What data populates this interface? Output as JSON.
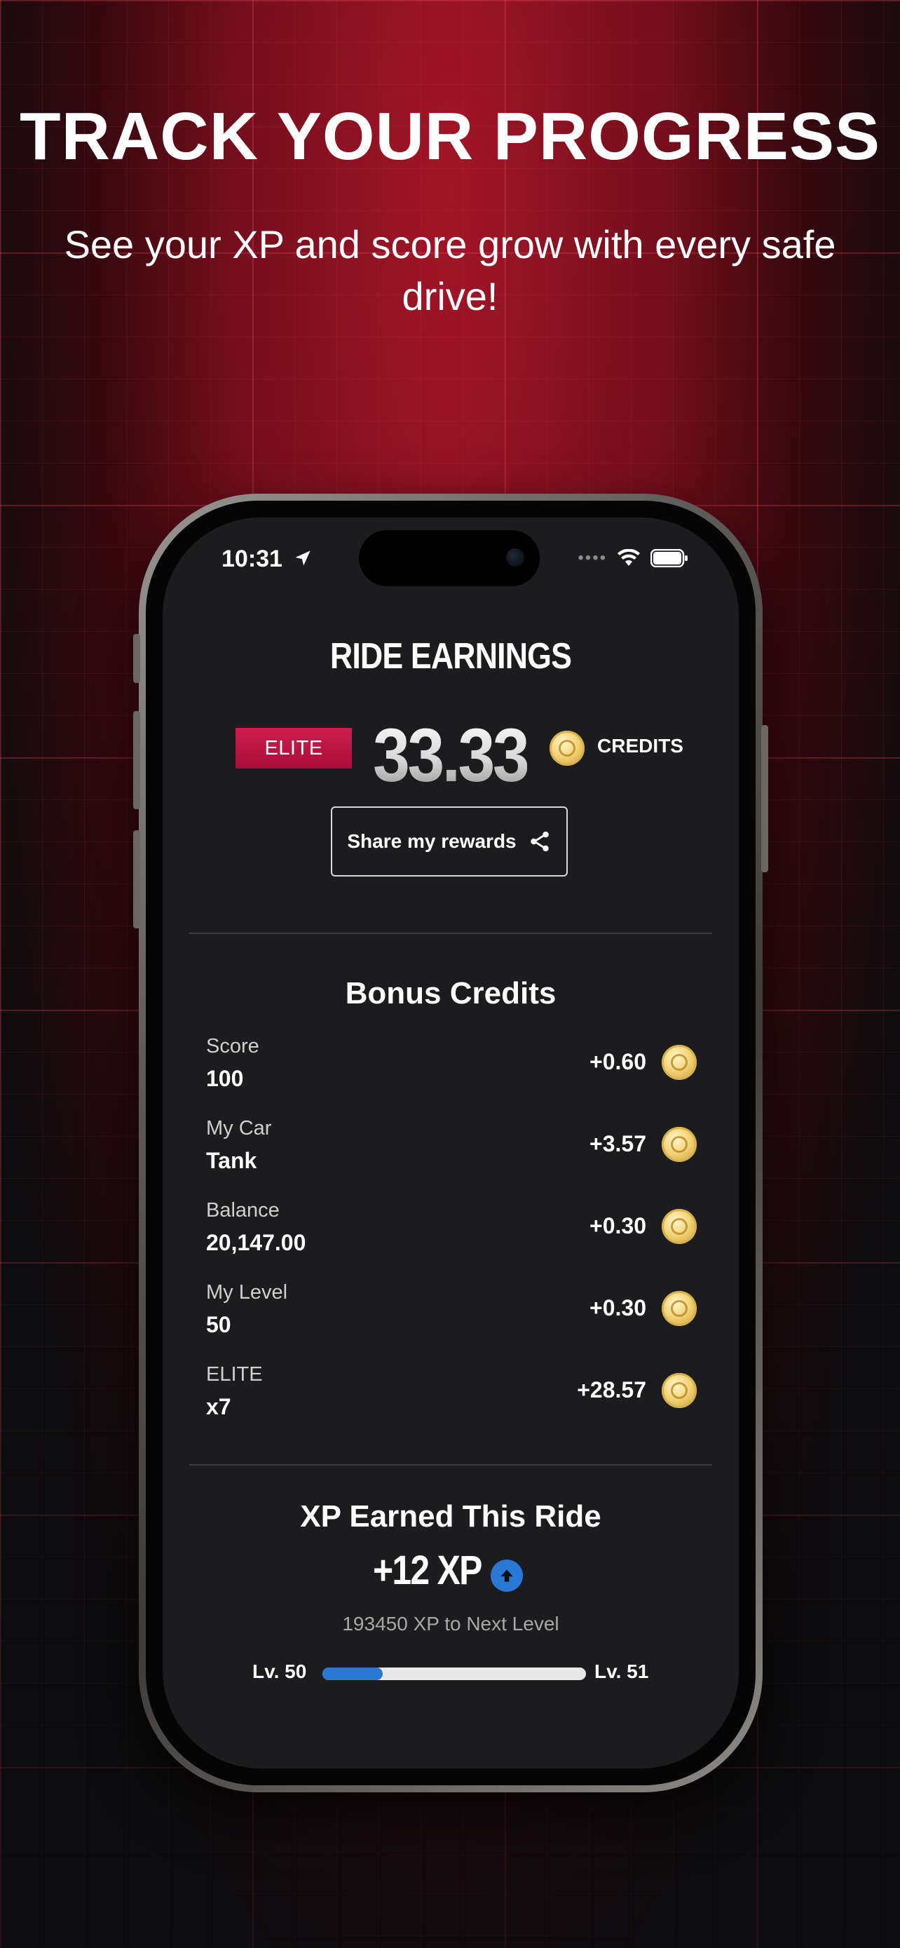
{
  "promo": {
    "headline": "TRACK YOUR PROGRESS",
    "subheadline": "See your XP and score grow with every safe drive!"
  },
  "status_bar": {
    "time": "10:31",
    "icons": [
      "location-arrow-icon",
      "signal-dots-icon",
      "wifi-icon",
      "battery-icon"
    ]
  },
  "ride_earnings": {
    "title": "RIDE EARNINGS",
    "tier_badge": "ELITE",
    "credits_value": "33.33",
    "credits_label": "CREDITS",
    "share_button": "Share my rewards"
  },
  "bonus_credits": {
    "title": "Bonus Credits",
    "rows": [
      {
        "label": "Score",
        "value": "100",
        "amount": "+0.60"
      },
      {
        "label": "My Car",
        "value": "Tank",
        "amount": "+3.57"
      },
      {
        "label": "Balance",
        "value": "20,147.00",
        "amount": "+0.30"
      },
      {
        "label": "My Level",
        "value": "50",
        "amount": "+0.30"
      },
      {
        "label": "ELITE",
        "value": "x7",
        "amount": "+28.57"
      }
    ]
  },
  "xp": {
    "title": "XP Earned This Ride",
    "earned": "+12 XP",
    "to_next_level": "193450 XP to Next Level",
    "level_current": "Lv. 50",
    "level_next": "Lv. 51",
    "progress_fraction": 0.23
  },
  "colors": {
    "accent_red": "#c8163f",
    "progress_blue": "#2a78d6",
    "coin_gold": "#f2d478",
    "screen_bg": "#1c1c1e"
  }
}
